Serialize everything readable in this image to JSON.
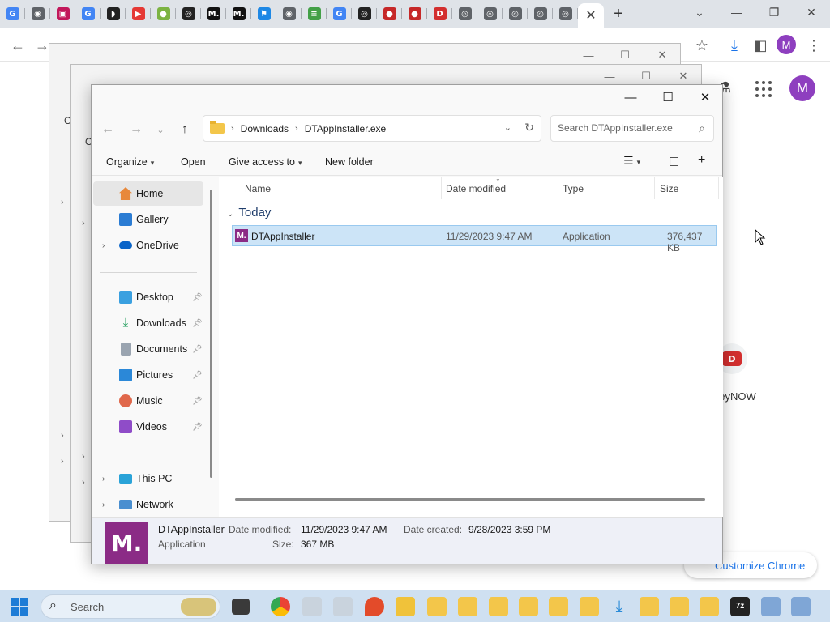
{
  "browser": {
    "tabs": [
      {
        "icon": "google-icon",
        "color": "#4285f4",
        "glyph": "G"
      },
      {
        "icon": "globe-icon",
        "color": "#5f6368",
        "glyph": "◉"
      },
      {
        "icon": "square-app-icon",
        "color": "#c2185b",
        "glyph": "▣"
      },
      {
        "icon": "google-icon",
        "color": "#4285f4",
        "glyph": "G"
      },
      {
        "icon": "dark-app-icon",
        "color": "#222222",
        "glyph": "◗"
      },
      {
        "icon": "youtube-icon",
        "color": "#e53935",
        "glyph": "▶"
      },
      {
        "icon": "green-app-icon",
        "color": "#7cb342",
        "glyph": "●"
      },
      {
        "icon": "seal-icon",
        "color": "#222222",
        "glyph": "◎"
      },
      {
        "icon": "medium-icon",
        "color": "#111111",
        "glyph": "M."
      },
      {
        "icon": "medium-icon",
        "color": "#111111",
        "glyph": "M."
      },
      {
        "icon": "blue-flag-icon",
        "color": "#1e88e5",
        "glyph": "⚑"
      },
      {
        "icon": "globe-icon",
        "color": "#5f6368",
        "glyph": "◉"
      },
      {
        "icon": "green-lines-icon",
        "color": "#43a047",
        "glyph": "≡"
      },
      {
        "icon": "google-icon",
        "color": "#4285f4",
        "glyph": "G"
      },
      {
        "icon": "seal-icon",
        "color": "#222222",
        "glyph": "◎"
      },
      {
        "icon": "red-app-icon",
        "color": "#c62828",
        "glyph": "●"
      },
      {
        "icon": "red-app-icon",
        "color": "#c62828",
        "glyph": "●"
      },
      {
        "icon": "disney-now-icon",
        "color": "#d32f2f",
        "glyph": "D"
      },
      {
        "icon": "chrome-icon",
        "color": "#5f6368",
        "glyph": "◎"
      },
      {
        "icon": "chrome-icon",
        "color": "#5f6368",
        "glyph": "◎"
      },
      {
        "icon": "chrome-icon",
        "color": "#5f6368",
        "glyph": "◎"
      },
      {
        "icon": "chrome-icon",
        "color": "#5f6368",
        "glyph": "◎"
      },
      {
        "icon": "chrome-icon",
        "color": "#5f6368",
        "glyph": "◎"
      }
    ],
    "active_tab_close": "✕",
    "new_tab": "+",
    "profile_initial": "M",
    "shortcut_label": "neyNOW",
    "customize_label": "Customize Chrome"
  },
  "explorer": {
    "address": {
      "crumbs": [
        "Downloads",
        "DTAppInstaller.exe"
      ]
    },
    "search": {
      "placeholder": "Search DTAppInstaller.exe"
    },
    "commands": {
      "organize": "Organize",
      "open": "Open",
      "give_access": "Give access to",
      "new_folder": "New folder"
    },
    "sidebar": {
      "home": "Home",
      "gallery": "Gallery",
      "onedrive": "OneDrive",
      "desktop": "Desktop",
      "downloads": "Downloads",
      "documents": "Documents",
      "pictures": "Pictures",
      "music": "Music",
      "videos": "Videos",
      "this_pc": "This PC",
      "network": "Network"
    },
    "columns": {
      "name": "Name",
      "date_modified": "Date modified",
      "type": "Type",
      "size": "Size"
    },
    "group": "Today",
    "file": {
      "icon_letter": "M.",
      "name": "DTAppInstaller",
      "date_modified": "11/29/2023 9:47 AM",
      "type": "Application",
      "size": "376,437 KB"
    },
    "details": {
      "icon_letter": "M.",
      "name": "DTAppInstaller",
      "type": "Application",
      "date_modified_label": "Date modified:",
      "date_modified": "11/29/2023 9:47 AM",
      "date_created_label": "Date created:",
      "date_created": "9/28/2023 3:59 PM",
      "size_label": "Size:",
      "size": "367 MB"
    }
  },
  "background_windows": {
    "label_fragment": "O"
  },
  "taskbar": {
    "search_placeholder": "Search"
  }
}
